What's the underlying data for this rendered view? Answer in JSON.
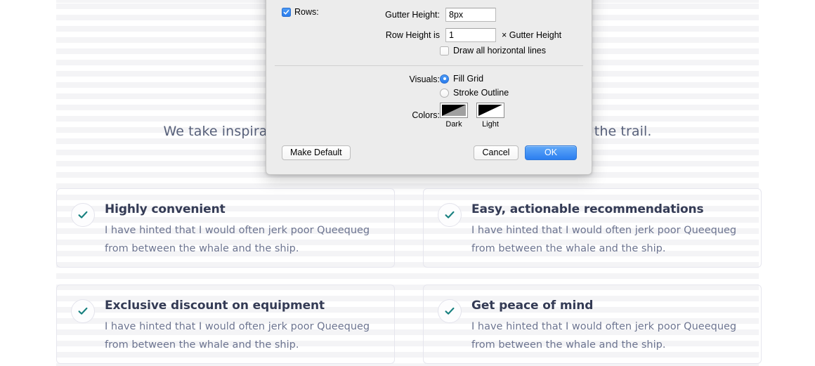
{
  "page": {
    "hero_paragraph": "We take inspiration from the open road and bring it with you to the trail.",
    "cards": [
      {
        "icon": "check-icon",
        "title": "Highly convenient",
        "body": "I have hinted that I would often jerk poor Queequeg from between the whale and the ship."
      },
      {
        "icon": "check-icon",
        "title": "Easy, actionable recommendations",
        "body": "I have hinted that I would often jerk poor Queequeg from between the whale and the ship."
      },
      {
        "icon": "check-icon",
        "title": "Exclusive discount on equipment",
        "body": "I have hinted that I would often jerk poor Queequeg from between the whale and the ship."
      },
      {
        "icon": "check-icon",
        "title": "Get peace of mind",
        "body": "I have hinted that I would often jerk poor Queequeg from between the whale and the ship."
      }
    ]
  },
  "dialog": {
    "rows": {
      "checkbox_label": "Rows:",
      "checkbox_checked": true
    },
    "gutter_height": {
      "label": "Gutter Height:",
      "value": "8px"
    },
    "row_height": {
      "label": "Row Height is",
      "value": "1",
      "suffix": "× Gutter Height"
    },
    "draw_all_horizontal_lines": {
      "label": "Draw all horizontal lines",
      "checked": false
    },
    "visuals": {
      "label": "Visuals:",
      "options": [
        {
          "label": "Fill Grid",
          "selected": true
        },
        {
          "label": "Stroke Outline",
          "selected": false
        }
      ]
    },
    "colors": {
      "label": "Colors:",
      "swatches": [
        {
          "caption": "Dark",
          "fill": "#a0a0a0",
          "triangle": "#000000"
        },
        {
          "caption": "Light",
          "fill": "#ffffff",
          "triangle": "#000000"
        }
      ]
    },
    "buttons": {
      "make_default": "Make Default",
      "cancel": "Cancel",
      "ok": "OK"
    }
  },
  "colors": {
    "accent_blue": "#2b7ef0",
    "check_teal": "#17807f",
    "heading": "#343b55",
    "body_text": "#6c7490",
    "card_border": "#e6e6ee",
    "stripe": "#f4f4f6",
    "dialog_bg": "#ececec"
  }
}
